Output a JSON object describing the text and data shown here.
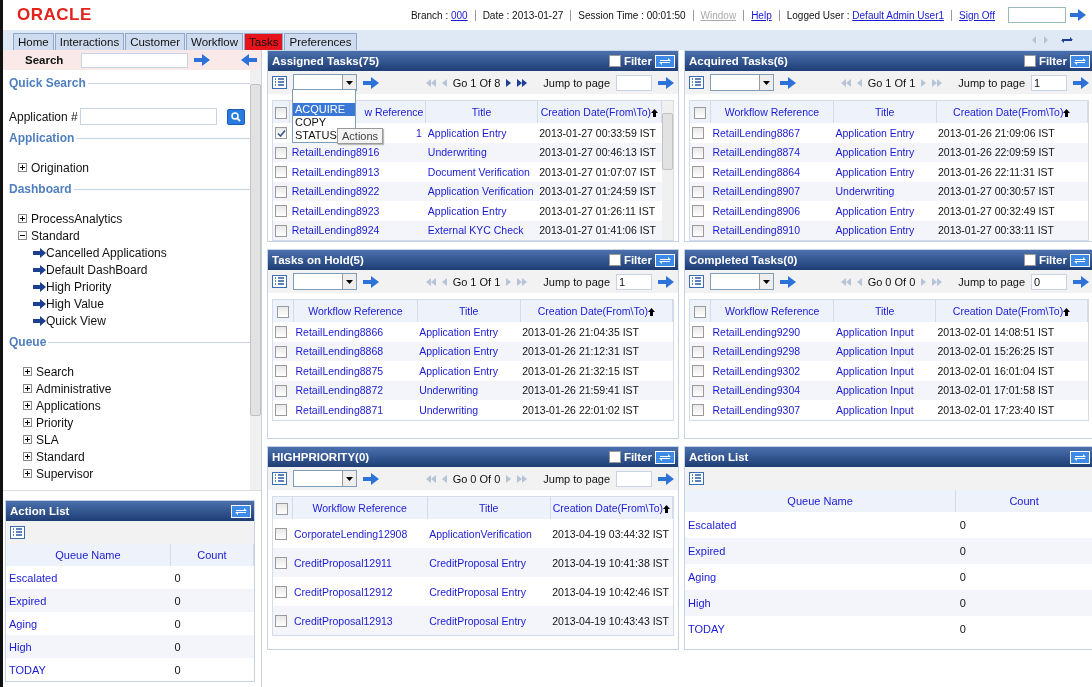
{
  "header": {
    "logo": "ORACLE",
    "status": [
      {
        "kind": "field",
        "label": "Branch :",
        "value": "000"
      },
      {
        "kind": "text",
        "label": "Date : 2013-01-27"
      },
      {
        "kind": "text",
        "label": "Session Time : 00:01:50"
      },
      {
        "kind": "link",
        "label": "Window",
        "disabled": true
      },
      {
        "kind": "link",
        "label": "Help",
        "disabled": false
      },
      {
        "kind": "field",
        "label": "Logged User :",
        "value": "Default Admin User1"
      },
      {
        "kind": "link",
        "label": "Sign Off",
        "disabled": false
      }
    ]
  },
  "tabs": [
    {
      "label": "Home",
      "selected": false
    },
    {
      "label": "Interactions",
      "selected": false
    },
    {
      "label": "Customer",
      "selected": false
    },
    {
      "label": "Workflow",
      "selected": false
    },
    {
      "label": "Tasks",
      "selected": true
    },
    {
      "label": "Preferences",
      "selected": false
    }
  ],
  "sidebar": {
    "search_label": "Search",
    "sections": [
      {
        "title": "Quick Search",
        "kind": "form",
        "field_label": "Application #"
      },
      {
        "title": "Application",
        "kind": "tree",
        "nodes": [
          {
            "label": "Origination",
            "expanded": false
          }
        ]
      },
      {
        "title": "Dashboard",
        "kind": "tree",
        "nodes": [
          {
            "label": "ProcessAnalytics",
            "expanded": false
          },
          {
            "label": "Standard",
            "expanded": true,
            "children": [
              {
                "label": "Cancelled Applications"
              },
              {
                "label": "Default DashBoard"
              },
              {
                "label": "High Priority"
              },
              {
                "label": "High Value"
              },
              {
                "label": "Quick View"
              }
            ]
          }
        ]
      },
      {
        "title": "Queue",
        "kind": "tree",
        "nodes": [
          {
            "label": "Search",
            "expanded": false
          },
          {
            "label": "Administrative",
            "expanded": false
          },
          {
            "label": "Applications",
            "expanded": false
          },
          {
            "label": "Priority",
            "expanded": false
          },
          {
            "label": "SLA",
            "expanded": false
          },
          {
            "label": "Standard",
            "expanded": false
          },
          {
            "label": "Supervisor",
            "expanded": false
          }
        ]
      }
    ],
    "action_list": {
      "title": "Action List",
      "columns": [
        "Queue Name",
        "Count"
      ],
      "rows": [
        {
          "name": "Escalated",
          "count": "0"
        },
        {
          "name": "Expired",
          "count": "0"
        },
        {
          "name": "Aging",
          "count": "0"
        },
        {
          "name": "High",
          "count": "0"
        },
        {
          "name": "TODAY",
          "count": "0"
        }
      ]
    }
  },
  "panels": [
    {
      "kind": "tasks",
      "title": "Assigned Tasks(75)",
      "filter_label": "Filter",
      "all_checked": false,
      "filter_checked": false,
      "pager": {
        "text": "Go 1 Of 8",
        "back_enabled": false,
        "forward_enabled": true
      },
      "jump_label": "Jump to page",
      "columns": [
        "w Reference",
        "Title",
        "Creation Date(From\\To)"
      ],
      "menu": {
        "options": [
          {
            "label": "ACQUIRE",
            "selected": true
          },
          {
            "label": "COPY",
            "selected": false
          },
          {
            "label": "STATUS",
            "selected": false
          }
        ],
        "tooltip": "Actions"
      },
      "rows": [
        {
          "checked": true,
          "ref": "1",
          "title": "Application Entry",
          "date": "2013-01-27 00:33:59 IST"
        },
        {
          "checked": false,
          "ref": "RetailLending8916",
          "title": "Underwriting",
          "date": "2013-01-27 00:46:13 IST"
        },
        {
          "checked": false,
          "ref": "RetailLending8913",
          "title": "Document Verification",
          "date": "2013-01-27 01:07:07 IST"
        },
        {
          "checked": false,
          "ref": "RetailLending8922",
          "title": "Application Verification",
          "date": "2013-01-27 01:24:59 IST"
        },
        {
          "checked": false,
          "ref": "RetailLending8923",
          "title": "Application Entry",
          "date": "2013-01-27 01:26:11 IST"
        },
        {
          "checked": false,
          "ref": "RetailLending8924",
          "title": "External KYC Check",
          "date": "2013-01-27 01:41:06 IST"
        }
      ]
    },
    {
      "kind": "tasks",
      "title": "Acquired Tasks(6)",
      "filter_label": "Filter",
      "all_checked": false,
      "filter_checked": false,
      "pager": {
        "text": "Go 1 Of 1",
        "back_enabled": false,
        "forward_enabled": false
      },
      "jump_label": "Jump to page",
      "jump_value": "1",
      "columns": [
        "Workflow Reference",
        "Title",
        "Creation Date(From\\To)"
      ],
      "rows": [
        {
          "checked": false,
          "ref": "RetailLending8867",
          "title": "Application Entry",
          "date": "2013-01-26 21:09:06 IST"
        },
        {
          "checked": false,
          "ref": "RetailLending8874",
          "title": "Application Entry",
          "date": "2013-01-26 22:09:59 IST"
        },
        {
          "checked": false,
          "ref": "RetailLending8864",
          "title": "Application Entry",
          "date": "2013-01-26 22:11:31 IST"
        },
        {
          "checked": false,
          "ref": "RetailLending8907",
          "title": "Underwriting",
          "date": "2013-01-27 00:30:57 IST"
        },
        {
          "checked": false,
          "ref": "RetailLending8906",
          "title": "Application Entry",
          "date": "2013-01-27 00:32:49 IST"
        },
        {
          "checked": false,
          "ref": "RetailLending8910",
          "title": "Application Entry",
          "date": "2013-01-27 00:33:11 IST"
        }
      ]
    },
    {
      "kind": "tasks",
      "title": "Tasks on Hold(5)",
      "filter_label": "Filter",
      "all_checked": false,
      "filter_checked": false,
      "pager": {
        "text": "Go 1 Of 1",
        "back_enabled": false,
        "forward_enabled": false
      },
      "jump_label": "Jump to page",
      "jump_value": "1",
      "columns": [
        "Workflow Reference",
        "Title",
        "Creation Date(From\\To)"
      ],
      "rows": [
        {
          "checked": false,
          "ref": "RetailLending8866",
          "title": "Application Entry",
          "date": "2013-01-26 21:04:35 IST"
        },
        {
          "checked": false,
          "ref": "RetailLending8868",
          "title": "Application Entry",
          "date": "2013-01-26 21:12:31 IST"
        },
        {
          "checked": false,
          "ref": "RetailLending8875",
          "title": "Application Entry",
          "date": "2013-01-26 21:32:15 IST"
        },
        {
          "checked": false,
          "ref": "RetailLending8872",
          "title": "Underwriting",
          "date": "2013-01-26 21:59:41 IST"
        },
        {
          "checked": false,
          "ref": "RetailLending8871",
          "title": "Underwriting",
          "date": "2013-01-26 22:01:02 IST"
        }
      ]
    },
    {
      "kind": "tasks",
      "title": "Completed Tasks(0)",
      "filter_label": "Filter",
      "all_checked": false,
      "filter_checked": false,
      "pager": {
        "text": "Go 0 Of 0",
        "back_enabled": false,
        "forward_enabled": false
      },
      "jump_label": "Jump to page",
      "jump_value": "0",
      "columns": [
        "Workflow Reference",
        "Title",
        "Creation Date(From\\To)"
      ],
      "rows": [
        {
          "checked": false,
          "ref": "RetailLending9290",
          "title": "Application Input",
          "date": "2013-02-01 14:08:51 IST"
        },
        {
          "checked": false,
          "ref": "RetailLending9298",
          "title": "Application Input",
          "date": "2013-02-01 15:26:25 IST"
        },
        {
          "checked": false,
          "ref": "RetailLending9302",
          "title": "Application Input",
          "date": "2013-02-01 16:01:04 IST"
        },
        {
          "checked": false,
          "ref": "RetailLending9304",
          "title": "Application Input",
          "date": "2013-02-01 17:01:58 IST"
        },
        {
          "checked": false,
          "ref": "RetailLending9307",
          "title": "Application Input",
          "date": "2013-02-01 17:23:40 IST"
        }
      ]
    },
    {
      "kind": "priority",
      "title": "HIGHPRIORITY(0)",
      "filter_label": "Filter",
      "all_checked": false,
      "filter_checked": false,
      "pager": {
        "text": "Go 0 Of 0",
        "back_enabled": false,
        "forward_enabled": false
      },
      "jump_label": "Jump to page",
      "columns": [
        "Workflow Reference",
        "Title",
        "Creation Date(From\\To)"
      ],
      "rows": [
        {
          "checked": false,
          "ref": "CorporateLending12908",
          "title": "ApplicationVerification",
          "date": "2013-04-19 03:44:32 IST"
        },
        {
          "checked": false,
          "ref": "CreditProposal12911",
          "title": "CreditProposal Entry",
          "date": "2013-04-19 10:41:38 IST"
        },
        {
          "checked": false,
          "ref": "CreditProposal12912",
          "title": "CreditProposal Entry",
          "date": "2013-04-19 10:42:46 IST"
        },
        {
          "checked": false,
          "ref": "CreditProposal12913",
          "title": "CreditProposal Entry",
          "date": "2013-04-19 10:43:43 IST"
        }
      ]
    },
    {
      "kind": "actions",
      "title": "Action List",
      "columns": [
        "Queue Name",
        "Count"
      ],
      "rows": [
        {
          "name": "Escalated",
          "count": "0"
        },
        {
          "name": "Expired",
          "count": "0"
        },
        {
          "name": "Aging",
          "count": "0"
        },
        {
          "name": "High",
          "count": "0"
        },
        {
          "name": "TODAY",
          "count": "0"
        }
      ]
    }
  ]
}
